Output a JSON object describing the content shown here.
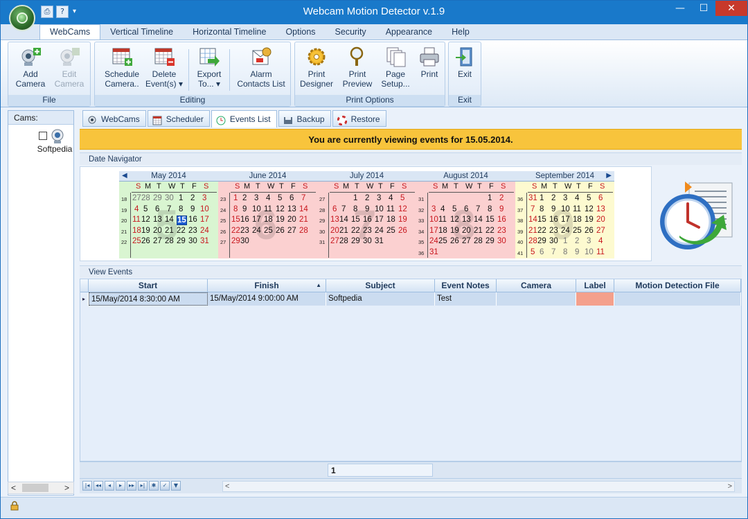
{
  "window": {
    "title": "Webcam Motion Detector v.1.9"
  },
  "qat": {
    "print_glyph": "⎙",
    "help_glyph": "?",
    "dropdown_glyph": "▾"
  },
  "window_controls": {
    "minimize": "—",
    "maximize": "☐",
    "close": "✕"
  },
  "menu": [
    "WebCams",
    "Vertical Timeline",
    "Horizontal Timeline",
    "Options",
    "Security",
    "Appearance",
    "Help"
  ],
  "ribbon": {
    "groups": {
      "file": "File",
      "editing": "Editing",
      "print_options": "Print Options",
      "exit": "Exit"
    },
    "buttons": {
      "add_camera": [
        "Add",
        "Camera"
      ],
      "edit_camera": [
        "Edit",
        "Camera"
      ],
      "schedule_camera": [
        "Schedule",
        "Camera.."
      ],
      "delete_events": [
        "Delete",
        "Event(s) ▾"
      ],
      "export_to": [
        "Export",
        "To... ▾"
      ],
      "alarm_contacts": [
        "Alarm",
        "Contacts List"
      ],
      "print_designer": [
        "Print",
        "Designer"
      ],
      "print_preview": [
        "Print",
        "Preview"
      ],
      "page_setup": [
        "Page",
        "Setup..."
      ],
      "print": [
        "Print",
        ""
      ],
      "exit": [
        "Exit",
        ""
      ]
    }
  },
  "sidebar": {
    "header": "Cams:",
    "cam_label": "Softpedia",
    "scroll_left": "<",
    "scroll_right": ">"
  },
  "tabs": [
    "WebCams",
    "Scheduler",
    "Events List",
    "Backup",
    "Restore"
  ],
  "banner": "You are currently viewing events for 15.05.2014.",
  "sections": {
    "date_navigator": "Date Navigator",
    "view_events": "View Events"
  },
  "day_headers": [
    "S",
    "M",
    "T",
    "W",
    "T",
    "F",
    "S"
  ],
  "calendar": [
    {
      "title": "May 2014",
      "bgnum": "5",
      "bg": "#d9f5d1",
      "first_wd": 4,
      "days": 31,
      "prev_days": 30,
      "week_start": 18,
      "rows": 5
    },
    {
      "title": "June 2014",
      "bgnum": "6",
      "bg": "#fbd0d0",
      "first_wd": 0,
      "days": 30,
      "prev_days": 31,
      "week_start": 23,
      "rows": 5
    },
    {
      "title": "July 2014",
      "bgnum": "7",
      "bg": "#fbd0d0",
      "first_wd": 2,
      "days": 31,
      "prev_days": 30,
      "week_start": 27,
      "rows": 5
    },
    {
      "title": "August 2014",
      "bgnum": "8",
      "bg": "#fbd0d0",
      "first_wd": 5,
      "days": 31,
      "prev_days": 31,
      "week_start": 31,
      "rows": 6
    },
    {
      "title": "September 2014",
      "bgnum": "9",
      "bg": "#fdfad0",
      "first_wd": 1,
      "days": 30,
      "prev_days": 31,
      "week_start": 36,
      "rows": 6
    }
  ],
  "selected_day": {
    "month_index": 0,
    "day": 15
  },
  "grid": {
    "columns": [
      "Start",
      "Finish",
      "Subject",
      "Event Notes",
      "Camera",
      "Label",
      "Motion Detection File"
    ],
    "sort_indicator": "▲",
    "rows": [
      {
        "start": "15/May/2014 8:30:00 AM",
        "finish": "15/May/2014 9:00:00 AM",
        "subject": "Softpedia",
        "notes": "Test",
        "camera": "",
        "label_color": "#f4a08c",
        "file": ""
      }
    ],
    "row_indicator": "▸"
  },
  "pager": {
    "page": "1"
  },
  "nav_buttons": [
    "|◂",
    "◂◂",
    "◂",
    "▸",
    "▸▸",
    "▸|",
    "✱",
    "✓",
    "▼"
  ],
  "scroll": {
    "left": "<",
    "right": ">"
  },
  "colors": {
    "titlebar": "#1979ca",
    "banner": "#f8c43c",
    "selected": "#1a5bd1",
    "holiday_text": "#c8161d"
  }
}
